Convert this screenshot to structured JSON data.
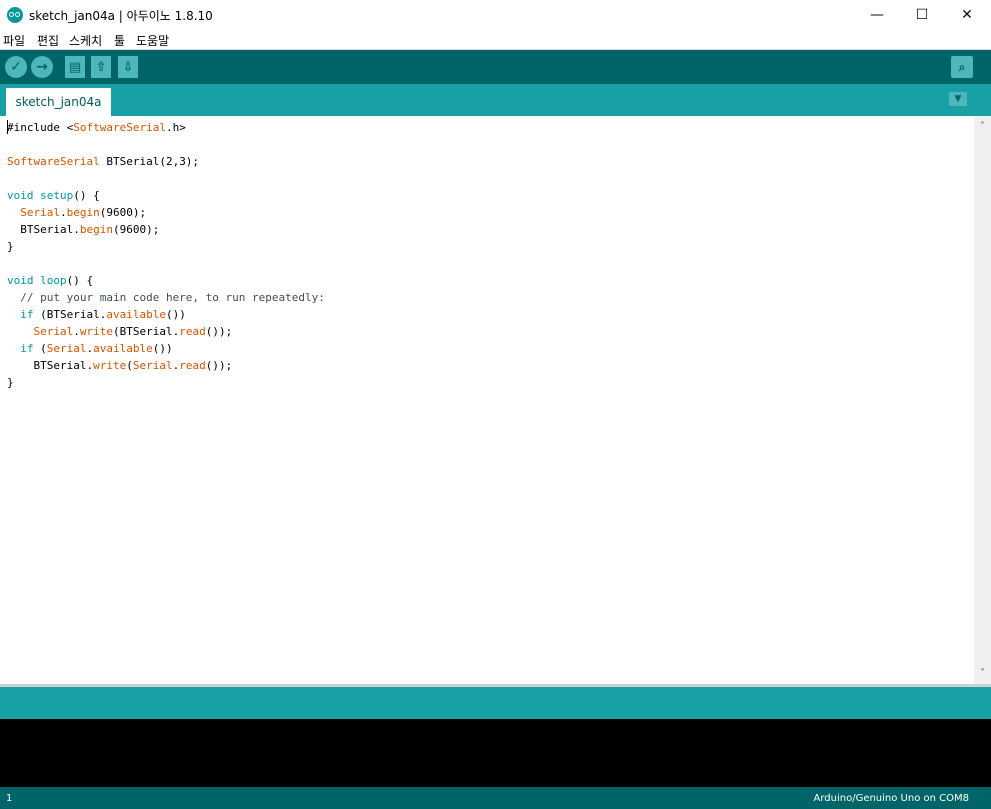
{
  "window": {
    "title": "sketch_jan04a | 아두이노 1.8.10",
    "minimize": "—",
    "maximize": "☐",
    "close": "✕"
  },
  "menu": [
    "파일",
    "편집",
    "스케치",
    "툴",
    "도움말"
  ],
  "toolbar": {
    "verify": "✓",
    "upload": "→",
    "new": "▤",
    "open": "⇧",
    "save": "⇩",
    "serial_monitor": "⌕"
  },
  "tabs": [
    {
      "label": "sketch_jan04a"
    }
  ],
  "tab_menu": "▼",
  "code": [
    [
      {
        "s": "#include <"
      },
      {
        "s": "SoftwareSerial",
        "c": "t"
      },
      {
        "s": ".h>"
      }
    ],
    [],
    [
      {
        "s": "SoftwareSerial",
        "c": "t"
      },
      {
        "s": " BTSerial(2,3);"
      }
    ],
    [],
    [
      {
        "s": "void",
        "c": "k"
      },
      {
        "s": " "
      },
      {
        "s": "setup",
        "c": "k"
      },
      {
        "s": "() {"
      }
    ],
    [
      {
        "s": "  "
      },
      {
        "s": "Serial",
        "c": "t"
      },
      {
        "s": "."
      },
      {
        "s": "begin",
        "c": "f"
      },
      {
        "s": "(9600);"
      }
    ],
    [
      {
        "s": "  BTSerial."
      },
      {
        "s": "begin",
        "c": "f"
      },
      {
        "s": "(9600);"
      }
    ],
    [
      {
        "s": "}"
      }
    ],
    [],
    [
      {
        "s": "void",
        "c": "k"
      },
      {
        "s": " "
      },
      {
        "s": "loop",
        "c": "k"
      },
      {
        "s": "() {"
      }
    ],
    [
      {
        "s": "  // put your main code here, to run repeatedly:",
        "c": "c"
      }
    ],
    [
      {
        "s": "  "
      },
      {
        "s": "if",
        "c": "k"
      },
      {
        "s": " (BTSerial."
      },
      {
        "s": "available",
        "c": "f"
      },
      {
        "s": "())"
      }
    ],
    [
      {
        "s": "    "
      },
      {
        "s": "Serial",
        "c": "t"
      },
      {
        "s": "."
      },
      {
        "s": "write",
        "c": "f"
      },
      {
        "s": "(BTSerial."
      },
      {
        "s": "read",
        "c": "f"
      },
      {
        "s": "());"
      }
    ],
    [
      {
        "s": "  "
      },
      {
        "s": "if",
        "c": "k"
      },
      {
        "s": " ("
      },
      {
        "s": "Serial",
        "c": "t"
      },
      {
        "s": "."
      },
      {
        "s": "available",
        "c": "f"
      },
      {
        "s": "())"
      }
    ],
    [
      {
        "s": "    BTSerial."
      },
      {
        "s": "write",
        "c": "f"
      },
      {
        "s": "("
      },
      {
        "s": "Serial",
        "c": "t"
      },
      {
        "s": "."
      },
      {
        "s": "read",
        "c": "f"
      },
      {
        "s": "());"
      }
    ],
    [
      {
        "s": "}"
      }
    ]
  ],
  "scroll": {
    "up": "˄",
    "down": "˅"
  },
  "status": {
    "line": "1",
    "board": "Arduino/Genuino Uno on COM8"
  },
  "colors": {
    "toolbar": "#006468",
    "tabbar": "#17a1a5",
    "keyword": "#00979c",
    "type": "#d35400"
  }
}
